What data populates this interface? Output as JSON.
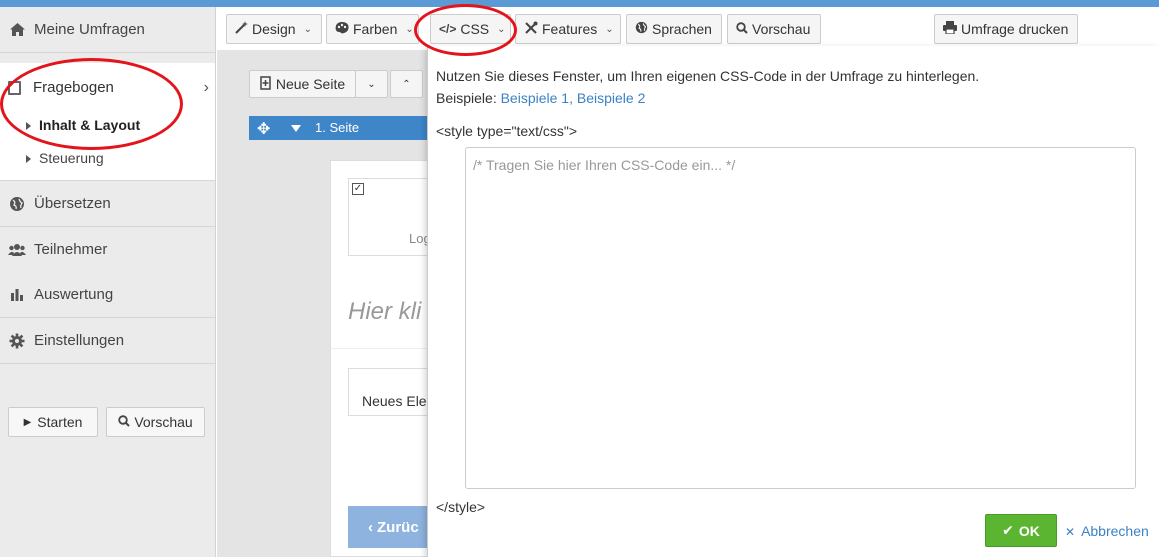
{
  "sidebar": {
    "items": [
      {
        "label": "Meine Umfragen",
        "icon": "home-icon"
      },
      {
        "label": "Übersetzen",
        "icon": "globe-icon"
      },
      {
        "label": "Teilnehmer",
        "icon": "users-icon"
      },
      {
        "label": "Auswertung",
        "icon": "bar-chart-icon"
      },
      {
        "label": "Einstellungen",
        "icon": "gear-icon"
      }
    ],
    "fragebogen": {
      "label": "Fragebogen",
      "sub": [
        "Inhalt & Layout",
        "Steuerung"
      ]
    },
    "start_label": "Starten",
    "preview_label": "Vorschau"
  },
  "toolbar": {
    "design": "Design",
    "farben": "Farben",
    "css": "CSS",
    "features": "Features",
    "sprachen": "Sprachen",
    "vorschau": "Vorschau",
    "print": "Umfrage drucken"
  },
  "editor": {
    "new_page": "Neue Seite",
    "page_label": "1. Seite",
    "logo_partial": "Log",
    "hier_partial": "Hier kli",
    "new_element_partial": "Neues Ele",
    "back_partial": "Zurüc"
  },
  "dialog": {
    "intro": "Nutzen Sie dieses Fenster, um Ihren eigenen CSS-Code in der Umfrage zu hinterlegen.",
    "examples_prefix": "Beispiele:",
    "examples_link": "Beispiele 1, Beispiele 2",
    "open_tag": "<style type=\"text/css\">",
    "placeholder": "/* Tragen Sie hier Ihren CSS-Code ein... */",
    "close_tag": "</style>",
    "ok_label": "OK",
    "cancel_label": "Abbrechen"
  },
  "colors": {
    "accent": "#3f86c9",
    "ok": "#5cb531",
    "annotation": "#e3141b"
  }
}
